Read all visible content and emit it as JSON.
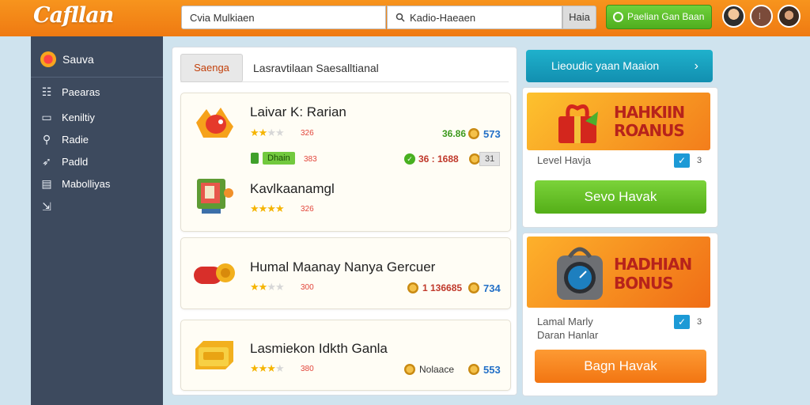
{
  "app": {
    "logo_text": "Cafllan"
  },
  "topbar": {
    "search_primary": "Cvia Mulkiaen",
    "search_secondary": "Kadio-Haeaen",
    "search_button": "Haia",
    "action_button": "Paelian Gan Baan"
  },
  "sidebar": {
    "brand": "Sauva",
    "items": [
      {
        "label": "Paearas",
        "icon": "list-icon"
      },
      {
        "label": "Keniltiy",
        "icon": "monitor-icon"
      },
      {
        "label": "Radie",
        "icon": "pin-icon"
      },
      {
        "label": "Padld",
        "icon": "rocket-icon"
      },
      {
        "label": "Mabolliyas",
        "icon": "card-icon"
      },
      {
        "label": "",
        "icon": "exit-icon"
      }
    ]
  },
  "main": {
    "tab_label": "Saenga",
    "title": "Lasravtilaan Saesalltianal",
    "games": [
      {
        "title": "Laivar K: Rarian",
        "rating": 2,
        "rating_count": "326",
        "price": "36.86",
        "coin_value": "573",
        "tag": "Dhain",
        "tag_count": "383",
        "price2": "36 : 1688",
        "pill": "31"
      },
      {
        "title": "Kavlkaanamgl",
        "rating": 4,
        "rating_count": "326"
      },
      {
        "title": "Humal Maanay Nanya Gercuer",
        "rating": 2,
        "rating_count": "300",
        "price": "1 136685",
        "coin_value": "734"
      },
      {
        "title": "Lasmiekon Idkth Ganla",
        "rating": 3,
        "rating_count": "380",
        "price": "Nolaace",
        "coin_value": "553"
      }
    ]
  },
  "right": {
    "promo": "Lieoudic yaan Maaion",
    "panel1": {
      "banner_line1": "HAHKIIN",
      "banner_line2": "ROANUS",
      "text": "Level Havja",
      "check_x": "3",
      "button": "Sevo Havak"
    },
    "panel2": {
      "banner_line1": "HADHIAN",
      "banner_line2": "BONUS",
      "text_line1": "Lamal Marly",
      "text_line2": "Daran Hanlar",
      "check_x": "3",
      "button": "Bagn Havak"
    }
  },
  "colors": {
    "topbar": "#f7941d",
    "sidebar": "#3d4a5e",
    "accent_green": "#5bb525",
    "accent_orange": "#f27512",
    "promo_blue": "#1aa5c3"
  }
}
